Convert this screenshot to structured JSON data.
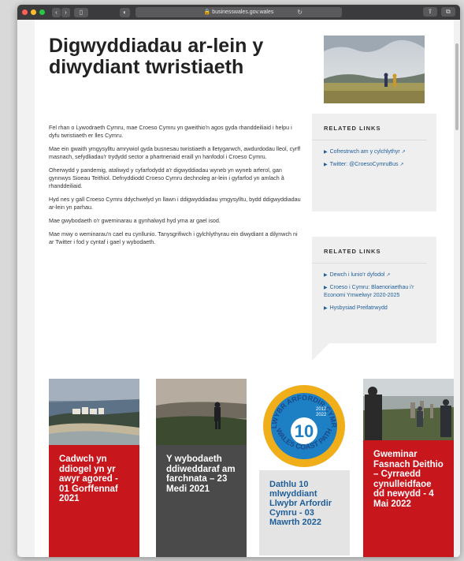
{
  "browser": {
    "address": "businesswales.gov.wales",
    "lock_icon": "lock-icon",
    "reload_icon": "reload-icon"
  },
  "page": {
    "title": "Digwyddiadau ar-lein y diwydiant twristiaeth",
    "paragraphs": [
      "Fel rhan o Lywodraeth Cymru, mae Croeso Cymru yn gweithio'n agos gyda rhanddeiliaid i helpu i dyfu twristiaeth er lles Cymru.",
      "Mae ein gwaith ymgysylltu amrywiol gyda busnesau twristiaeth a lletygarwch, awdurdodau lleol, cyrff masnach, sefydliadau'r trydydd sector a phartneriaid eraill yn hanfodol i Croeso Cymru.",
      "Oherwydd y pandemig, ataliwyd y cyfarfodydd a'r digwyddiadau wyneb yn wyneb arferol, gan gynnwys Sioeau Teithiol. Defnyddiodd Croeso Cymru dechnoleg ar-lein i gyfarfod yn amlach â rhanddeiliaid.",
      "Hyd nes y gall Croeso Cymru ddychwelyd yn llawn i ddigwyddiadau ymgysylltu, bydd ddigwyddiadau ar-lein yn parhau.",
      "Mae gwybodaeth o'r gweminarau a gynhalwyd hyd yma ar gael isod.",
      "Mae mwy o weminarau'n cael eu cynllunio. Tanysgrifiwch i gylchlythyrau ein diwydiant a dilynwch ni ar Twitter i fod y cyntaf i gael y wybodaeth."
    ]
  },
  "related1": {
    "heading": "RELATED LINKS",
    "links": [
      "Cofrestrwch am y cylchlythyr",
      "Twitter: @CroesoCymruBus"
    ]
  },
  "related2": {
    "heading": "RELATED LINKS",
    "links": [
      "Dewch i lunio'r dyfodol",
      "Croeso i Cymru: Blaenoriaethau i'r Economi Ymwelwyr 2020-2025",
      "Hysbysiad Preifatrwydd"
    ]
  },
  "badge": {
    "top_text": "LLWYBR ARFORDIR CYMRU",
    "bottom_text": "WALES COAST PATH",
    "year1": "2012",
    "year2": "2022",
    "number": "10"
  },
  "cards": [
    {
      "title": "Cadwch yn ddiogel yn yr awyr agored - 01 Gorffennaf 2021",
      "color": "#c8161d"
    },
    {
      "title": "Y wybodaeth ddiweddaraf am farchnata – 23 Medi 2021",
      "color": "#4a4a4a"
    },
    {
      "title": "Dathlu 10 mlwyddiant Llwybr Arfordir Cymru - 03 Mawrth 2022",
      "color": "#e4e4e4"
    },
    {
      "title": "Gweminar Fasnach Deithio – Cyrraedd cynulleidfaoe dd newydd - 4 Mai 2022",
      "color": "#c8161d"
    }
  ]
}
